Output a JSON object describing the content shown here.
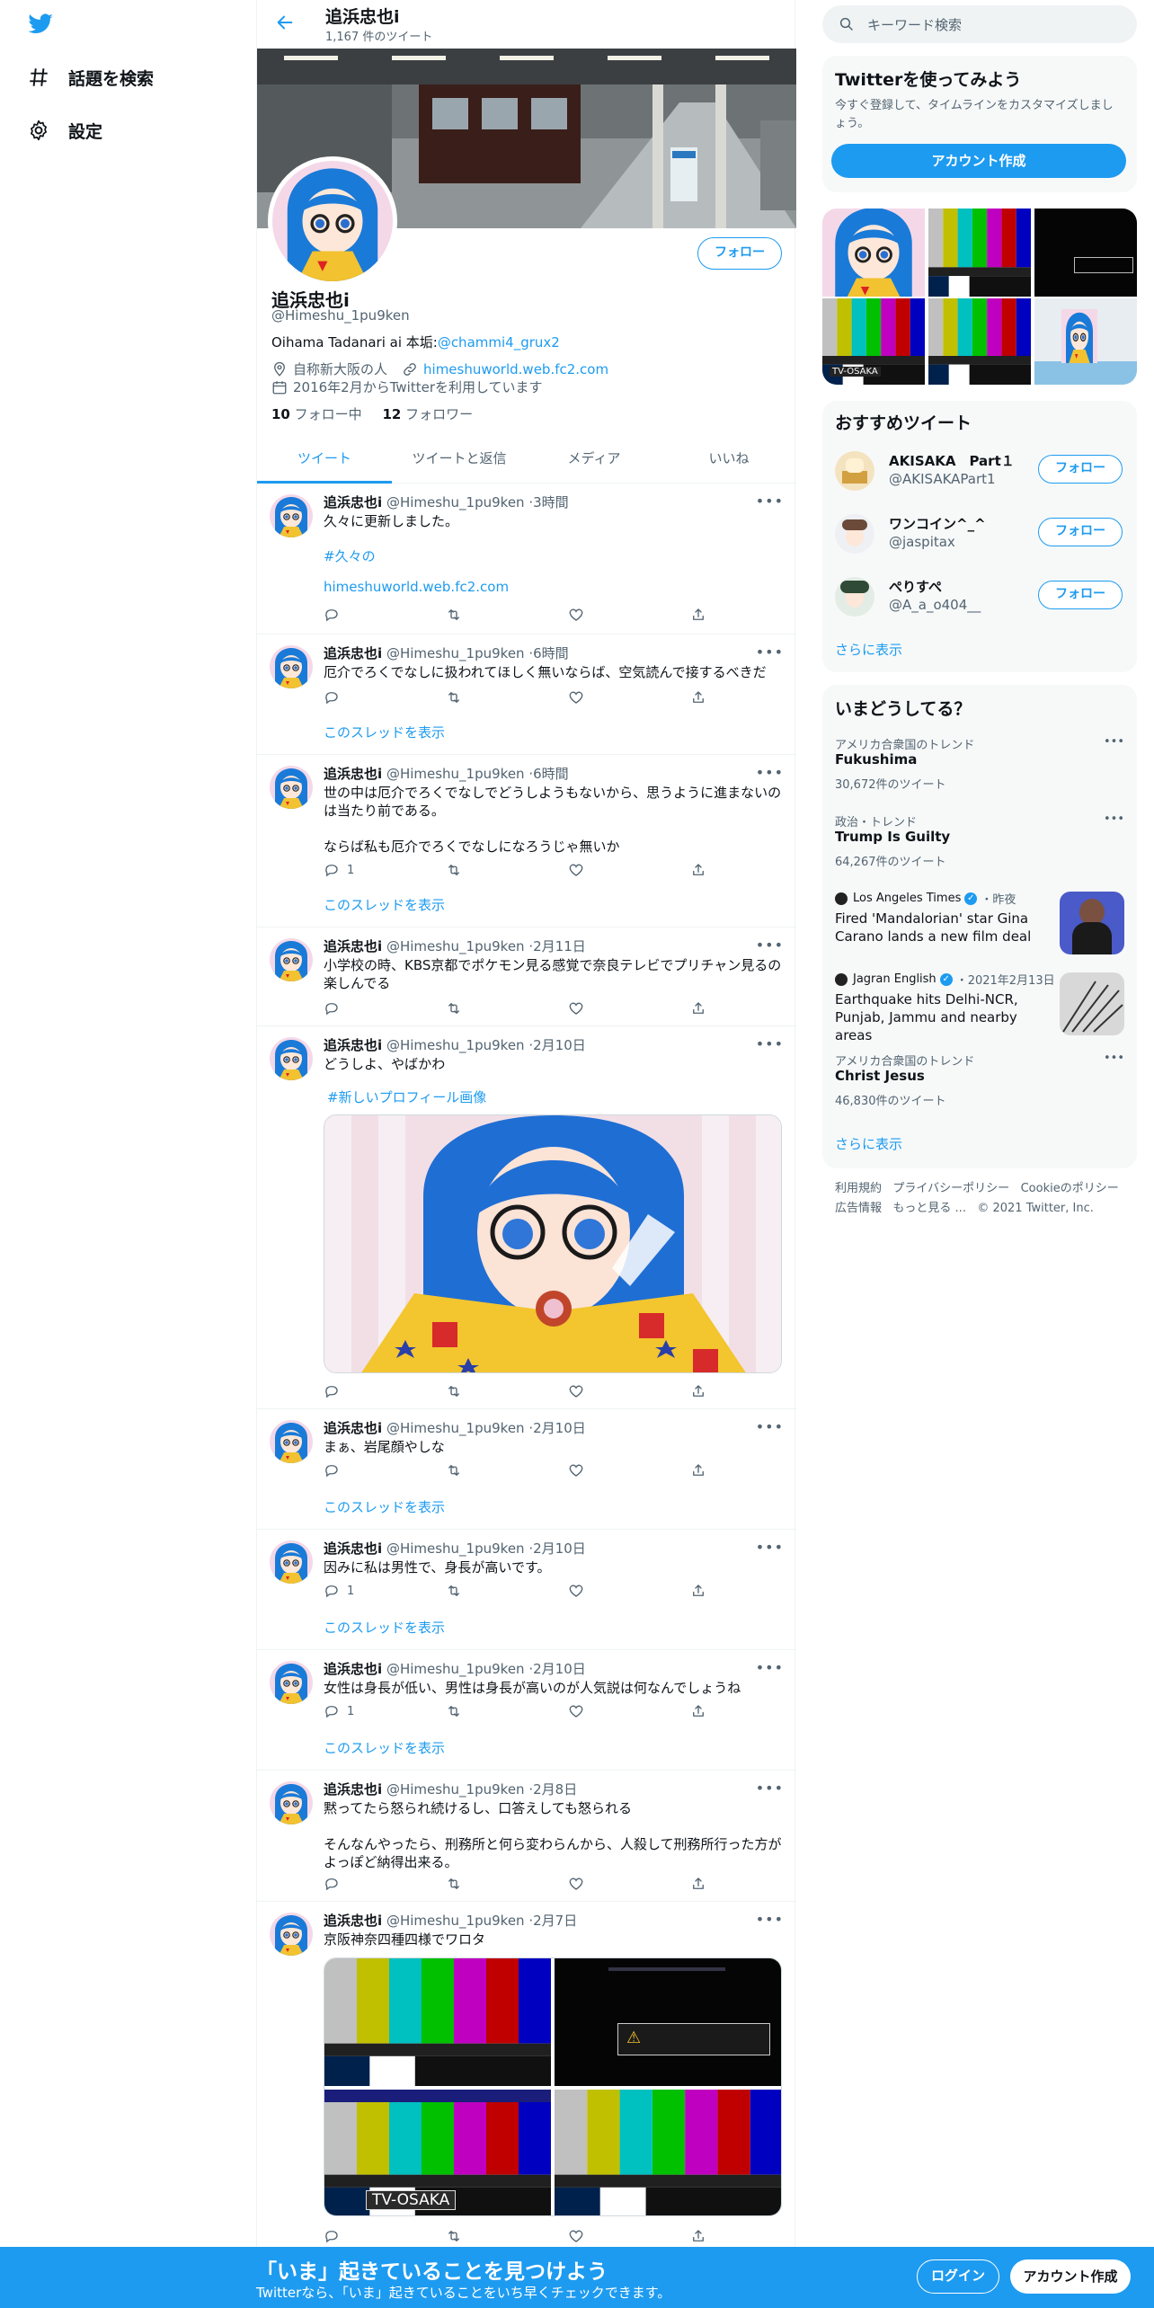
{
  "nav": {
    "explore": "話題を検索",
    "settings": "設定"
  },
  "header": {
    "name": "追浜忠也i",
    "tweet_count": "1,167 件のツイート"
  },
  "profile": {
    "follow": "フォロー",
    "name": "追浜忠也i",
    "handle": "@Himeshu_1pu9ken",
    "bio_text": "Oihama Tadanari ai 本垢:",
    "bio_link": "@chammi4_grux2",
    "location": "自称新大阪の人",
    "website": "himeshuworld.web.fc2.com",
    "joined": "2016年2月からTwitterを利用しています",
    "following_count": "10",
    "following_label": "フォロー中",
    "followers_count": "12",
    "followers_label": "フォロワー"
  },
  "tabs": [
    "ツイート",
    "ツイートと返信",
    "メディア",
    "いいね"
  ],
  "tweets": [
    {
      "name": "追浜忠也i",
      "handle": "@Himeshu_1pu9ken",
      "time": "3時間",
      "hashtag": "#久々の",
      "link": "himeshuworld.web.fc2.com",
      "text": "久々に更新しました。",
      "reply": ""
    },
    {
      "name": "追浜忠也i",
      "handle": "@Himeshu_1pu9ken",
      "time": "6時間",
      "text": "厄介でろくでなしに扱われてほしく無いならば、空気読んで接するべきだ",
      "reply": "",
      "thread": "このスレッドを表示"
    },
    {
      "name": "追浜忠也i",
      "handle": "@Himeshu_1pu9ken",
      "time": "6時間",
      "text": "世の中は厄介でろくでなしでどうしようもないから、思うように進まないのは当たり前である。\n\nならば私も厄介でろくでなしになろうじゃ無いか",
      "reply": "1",
      "thread": "このスレッドを表示"
    },
    {
      "name": "追浜忠也i",
      "handle": "@Himeshu_1pu9ken",
      "time": "2月11日",
      "text": "小学校の時、KBS京都でポケモン見る感覚で奈良テレビでプリチャン見るの楽しんでる",
      "reply": ""
    },
    {
      "name": "追浜忠也i",
      "handle": "@Himeshu_1pu9ken",
      "time": "2月10日",
      "text": "どうしよ、やばかわ",
      "hashtag": "#新しいプロフィール画像",
      "reply": ""
    },
    {
      "name": "追浜忠也i",
      "handle": "@Himeshu_1pu9ken",
      "time": "2月10日",
      "text": "まぁ、岩尾顔やしな",
      "reply": "",
      "thread": "このスレッドを表示"
    },
    {
      "name": "追浜忠也i",
      "handle": "@Himeshu_1pu9ken",
      "time": "2月10日",
      "text": "因みに私は男性で、身長が高いです。",
      "reply": "1",
      "thread": "このスレッドを表示"
    },
    {
      "name": "追浜忠也i",
      "handle": "@Himeshu_1pu9ken",
      "time": "2月10日",
      "text": "女性は身長が低い、男性は身長が高いのが人気説は何なんでしょうね",
      "reply": "1",
      "thread": "このスレッドを表示"
    },
    {
      "name": "追浜忠也i",
      "handle": "@Himeshu_1pu9ken",
      "time": "2月8日",
      "text": "黙ってたら怒られ続けるし、口答えしても怒られる\n\nそんなんやったら、刑務所と何ら変わらんから、人殺して刑務所行った方がよっぽど納得出来る。",
      "reply": ""
    },
    {
      "name": "追浜忠也i",
      "handle": "@Himeshu_1pu9ken",
      "time": "2月7日",
      "text": "京阪神奈四種四様でワロタ",
      "reply": ""
    }
  ],
  "media_label": "TV-OSAKA",
  "right": {
    "search_placeholder": "キーワード検索",
    "signup_card": {
      "title": "Twitterを使ってみよう",
      "desc": "今すぐ登録して、タイムラインをカスタマイズしましょう。",
      "button": "アカウント作成"
    },
    "recommend": {
      "title": "おすすめツイート",
      "users": [
        {
          "name": "AKISAKA　Part１",
          "handle": "@AKISAKAPart1",
          "button": "フォロー"
        },
        {
          "name": "ワンコイン^_^",
          "handle": "@jaspitax",
          "button": "フォロー"
        },
        {
          "name": "ぺりすぺ",
          "handle": "@A_a_o404__",
          "button": "フォロー"
        }
      ],
      "more": "さらに表示"
    },
    "trends": {
      "title": "いまどうしてる？",
      "items": [
        {
          "context": "アメリカ合衆国のトレンド",
          "title": "Fukushima",
          "count": "30,672件のツイート"
        },
        {
          "context": "政治・トレンド",
          "title": "Trump Is Guilty",
          "count": "64,267件のツイート"
        },
        {
          "source": "Los Angeles Times",
          "when": "・昨夜",
          "title": "Fired 'Mandalorian' star Gina Carano lands a new film deal"
        },
        {
          "source": "Jagran English",
          "when": "・2021年2月13日",
          "title": "Earthquake hits Delhi-NCR, Punjab, Jammu and nearby areas"
        },
        {
          "context": "アメリカ合衆国のトレンド",
          "title": "Christ Jesus",
          "count": "46,830件のツイート"
        }
      ],
      "more": "さらに表示"
    },
    "footer": {
      "terms": "利用規約",
      "privacy": "プライバシーポリシー",
      "cookie": "Cookieのポリシー",
      "ads": "広告情報",
      "more": "もっと見る ...",
      "copyright": "© 2021 Twitter, Inc."
    }
  },
  "bottom": {
    "title": "「いま」起きていることを見つけよう",
    "sub": "Twitterなら、「いま」起きていることをいち早くチェックできます。",
    "login": "ログイン",
    "signup": "アカウント作成"
  }
}
